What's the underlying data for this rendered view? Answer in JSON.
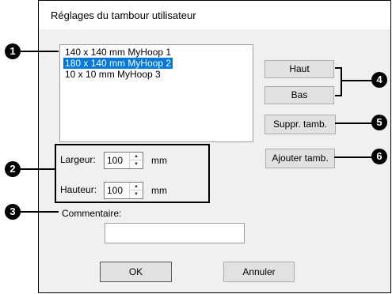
{
  "dialog": {
    "title": "Réglages du tambour utilisateur"
  },
  "hoop_list": {
    "items": [
      {
        "label": "140 x 140 mm MyHoop 1",
        "selected": false
      },
      {
        "label": "180 x 140 mm MyHoop 2",
        "selected": true
      },
      {
        "label": "10 x 10 mm MyHoop 3",
        "selected": false
      }
    ]
  },
  "buttons": {
    "up": "Haut",
    "down": "Bas",
    "delete": "Suppr. tamb.",
    "add": "Ajouter tamb.",
    "ok": "OK",
    "cancel": "Annuler"
  },
  "size": {
    "width_label": "Largeur:",
    "width_value": "100",
    "width_unit": "mm",
    "height_label": "Hauteur:",
    "height_value": "100",
    "height_unit": "mm"
  },
  "comment": {
    "label": "Commentaire:",
    "value": ""
  },
  "callouts": {
    "c1": "1",
    "c2": "2",
    "c3": "3",
    "c4": "4",
    "c5": "5",
    "c6": "6"
  },
  "colors": {
    "selection": "#0078d7",
    "button_face": "#e1e1e1",
    "dialog_bg": "#f0f0f0"
  }
}
